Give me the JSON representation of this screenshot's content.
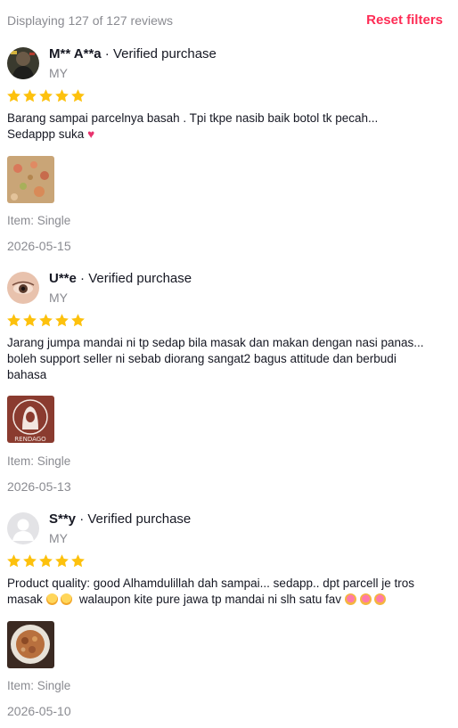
{
  "header": {
    "count_text": "Displaying 127 of 127 reviews",
    "reset_label": "Reset filters"
  },
  "colors": {
    "accent": "#fe2c55",
    "star": "#fdc10d",
    "muted": "#8a8b91"
  },
  "reviews": [
    {
      "name": "M** A**a",
      "verified": " · Verified purchase",
      "country": "MY",
      "rating": 5,
      "text_lines": [
        "Barang sampai parcelnya basah . Tpi tkpe nasib baik botol tk pecah...",
        "Sedappp suka"
      ],
      "item": "Item: Single",
      "date": "2026-05-15"
    },
    {
      "name": "U**e",
      "verified": " · Verified purchase",
      "country": "MY",
      "rating": 5,
      "text_lines": [
        "Jarang jumpa mandai ni tp sedap bila masak dan makan dengan nasi panas...",
        "boleh support seller ni sebab diorang sangat2 bagus attitude dan berbudi",
        "bahasa"
      ],
      "image_caption": "RENDAGO",
      "item": "Item: Single",
      "date": "2026-05-13"
    },
    {
      "name": "S**y",
      "verified": " · Verified purchase",
      "country": "MY",
      "rating": 5,
      "text_lines": [
        "Product quality: good Alhamdulillah dah sampai... sedapp.. dpt parcell je tros",
        "masak",
        "walaupon kite pure jawa tp mandai ni slh satu fav"
      ],
      "item": "Item: Single",
      "date": "2026-05-10"
    }
  ]
}
